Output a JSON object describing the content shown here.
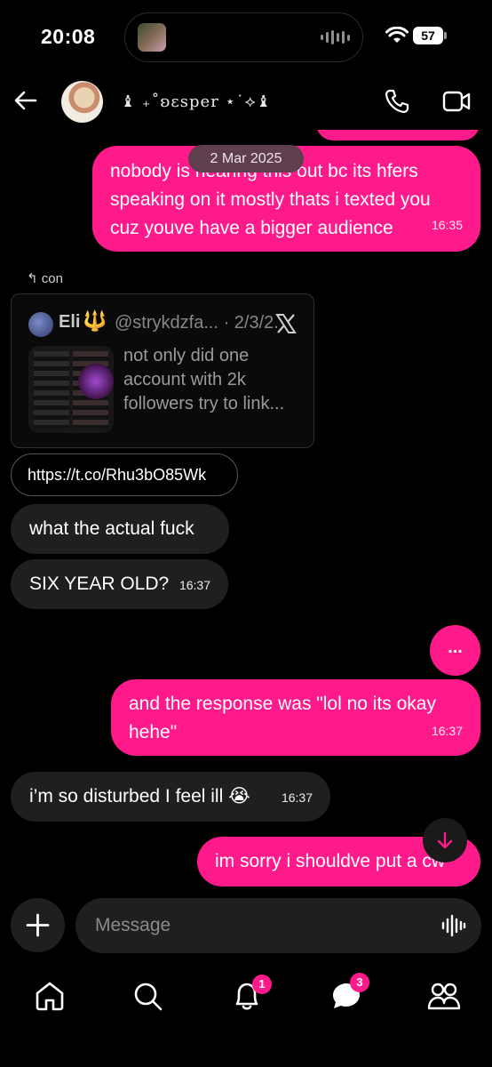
{
  "status_bar": {
    "time": "20:08",
    "battery": "57"
  },
  "header": {
    "contact_name": "♝ ₊˚ʚɛsper ⋆˙⟡♝"
  },
  "date_separator": "2 Mar 2025",
  "messages": [
    {
      "id": "m1",
      "direction": "out",
      "text": "nobody is hearing this out bc its hfers speaking on it mostly thats i texted you cuz youve have a bigger audience",
      "time": "16:35"
    },
    {
      "id": "m2",
      "direction": "in",
      "reply_label": "con",
      "link": "https://t.co/Rhu3bO85Wk",
      "tweet": {
        "name": "Eli",
        "handle": "@strykdzfa...",
        "date": "2/3/2...",
        "text": "not only did one account with 2k followers try to link..."
      }
    },
    {
      "id": "m3",
      "direction": "in",
      "text": "what the actual fuck"
    },
    {
      "id": "m4",
      "direction": "in",
      "text": "SIX YEAR OLD?",
      "time": "16:37"
    },
    {
      "id": "m5",
      "direction": "out",
      "text": "...",
      "kind": "more"
    },
    {
      "id": "m6",
      "direction": "out",
      "text": "and the response was \"lol no its okay hehe\"",
      "time": "16:37"
    },
    {
      "id": "m7",
      "direction": "in",
      "text": "i’m so disturbed I feel ill 😭",
      "time": "16:37"
    },
    {
      "id": "m8",
      "direction": "out",
      "text": "im sorry i shouldve put a cw"
    }
  ],
  "composer": {
    "placeholder": "Message"
  },
  "nav": {
    "notifications_badge": "1",
    "messages_badge": "3"
  },
  "colors": {
    "accent": "#ff1a8c",
    "incoming_bubble": "#1f1f1f",
    "background": "#000000"
  }
}
